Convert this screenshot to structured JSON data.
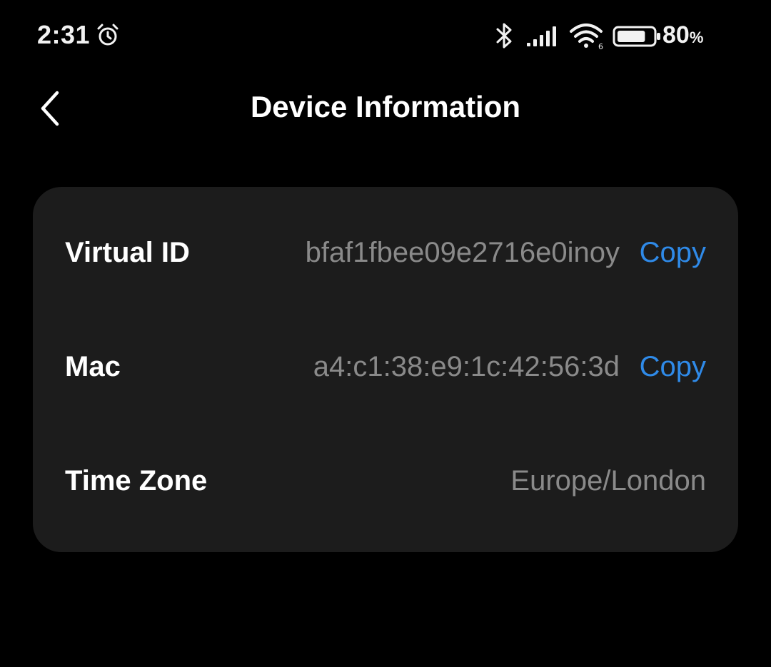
{
  "status_bar": {
    "time": "2:31",
    "battery_percent": "80",
    "battery_percent_sign": "%",
    "battery_level": 0.8,
    "wifi_badge": "6",
    "icons": [
      "alarm-icon",
      "bluetooth-icon",
      "signal-icon",
      "wifi-icon",
      "battery-icon"
    ]
  },
  "header": {
    "title": "Device Information",
    "back_icon": "chevron-left-icon"
  },
  "rows": [
    {
      "label": "Virtual ID",
      "value": "bfaf1fbee09e2716e0inoy",
      "action": "Copy"
    },
    {
      "label": "Mac",
      "value": "a4:c1:38:e9:1c:42:56:3d",
      "action": "Copy"
    },
    {
      "label": "Time Zone",
      "value": "Europe/London"
    }
  ],
  "colors": {
    "background": "#000000",
    "card": "#1c1c1c",
    "label": "#ffffff",
    "value": "#8a8a8a",
    "accent": "#2f8ae8"
  }
}
